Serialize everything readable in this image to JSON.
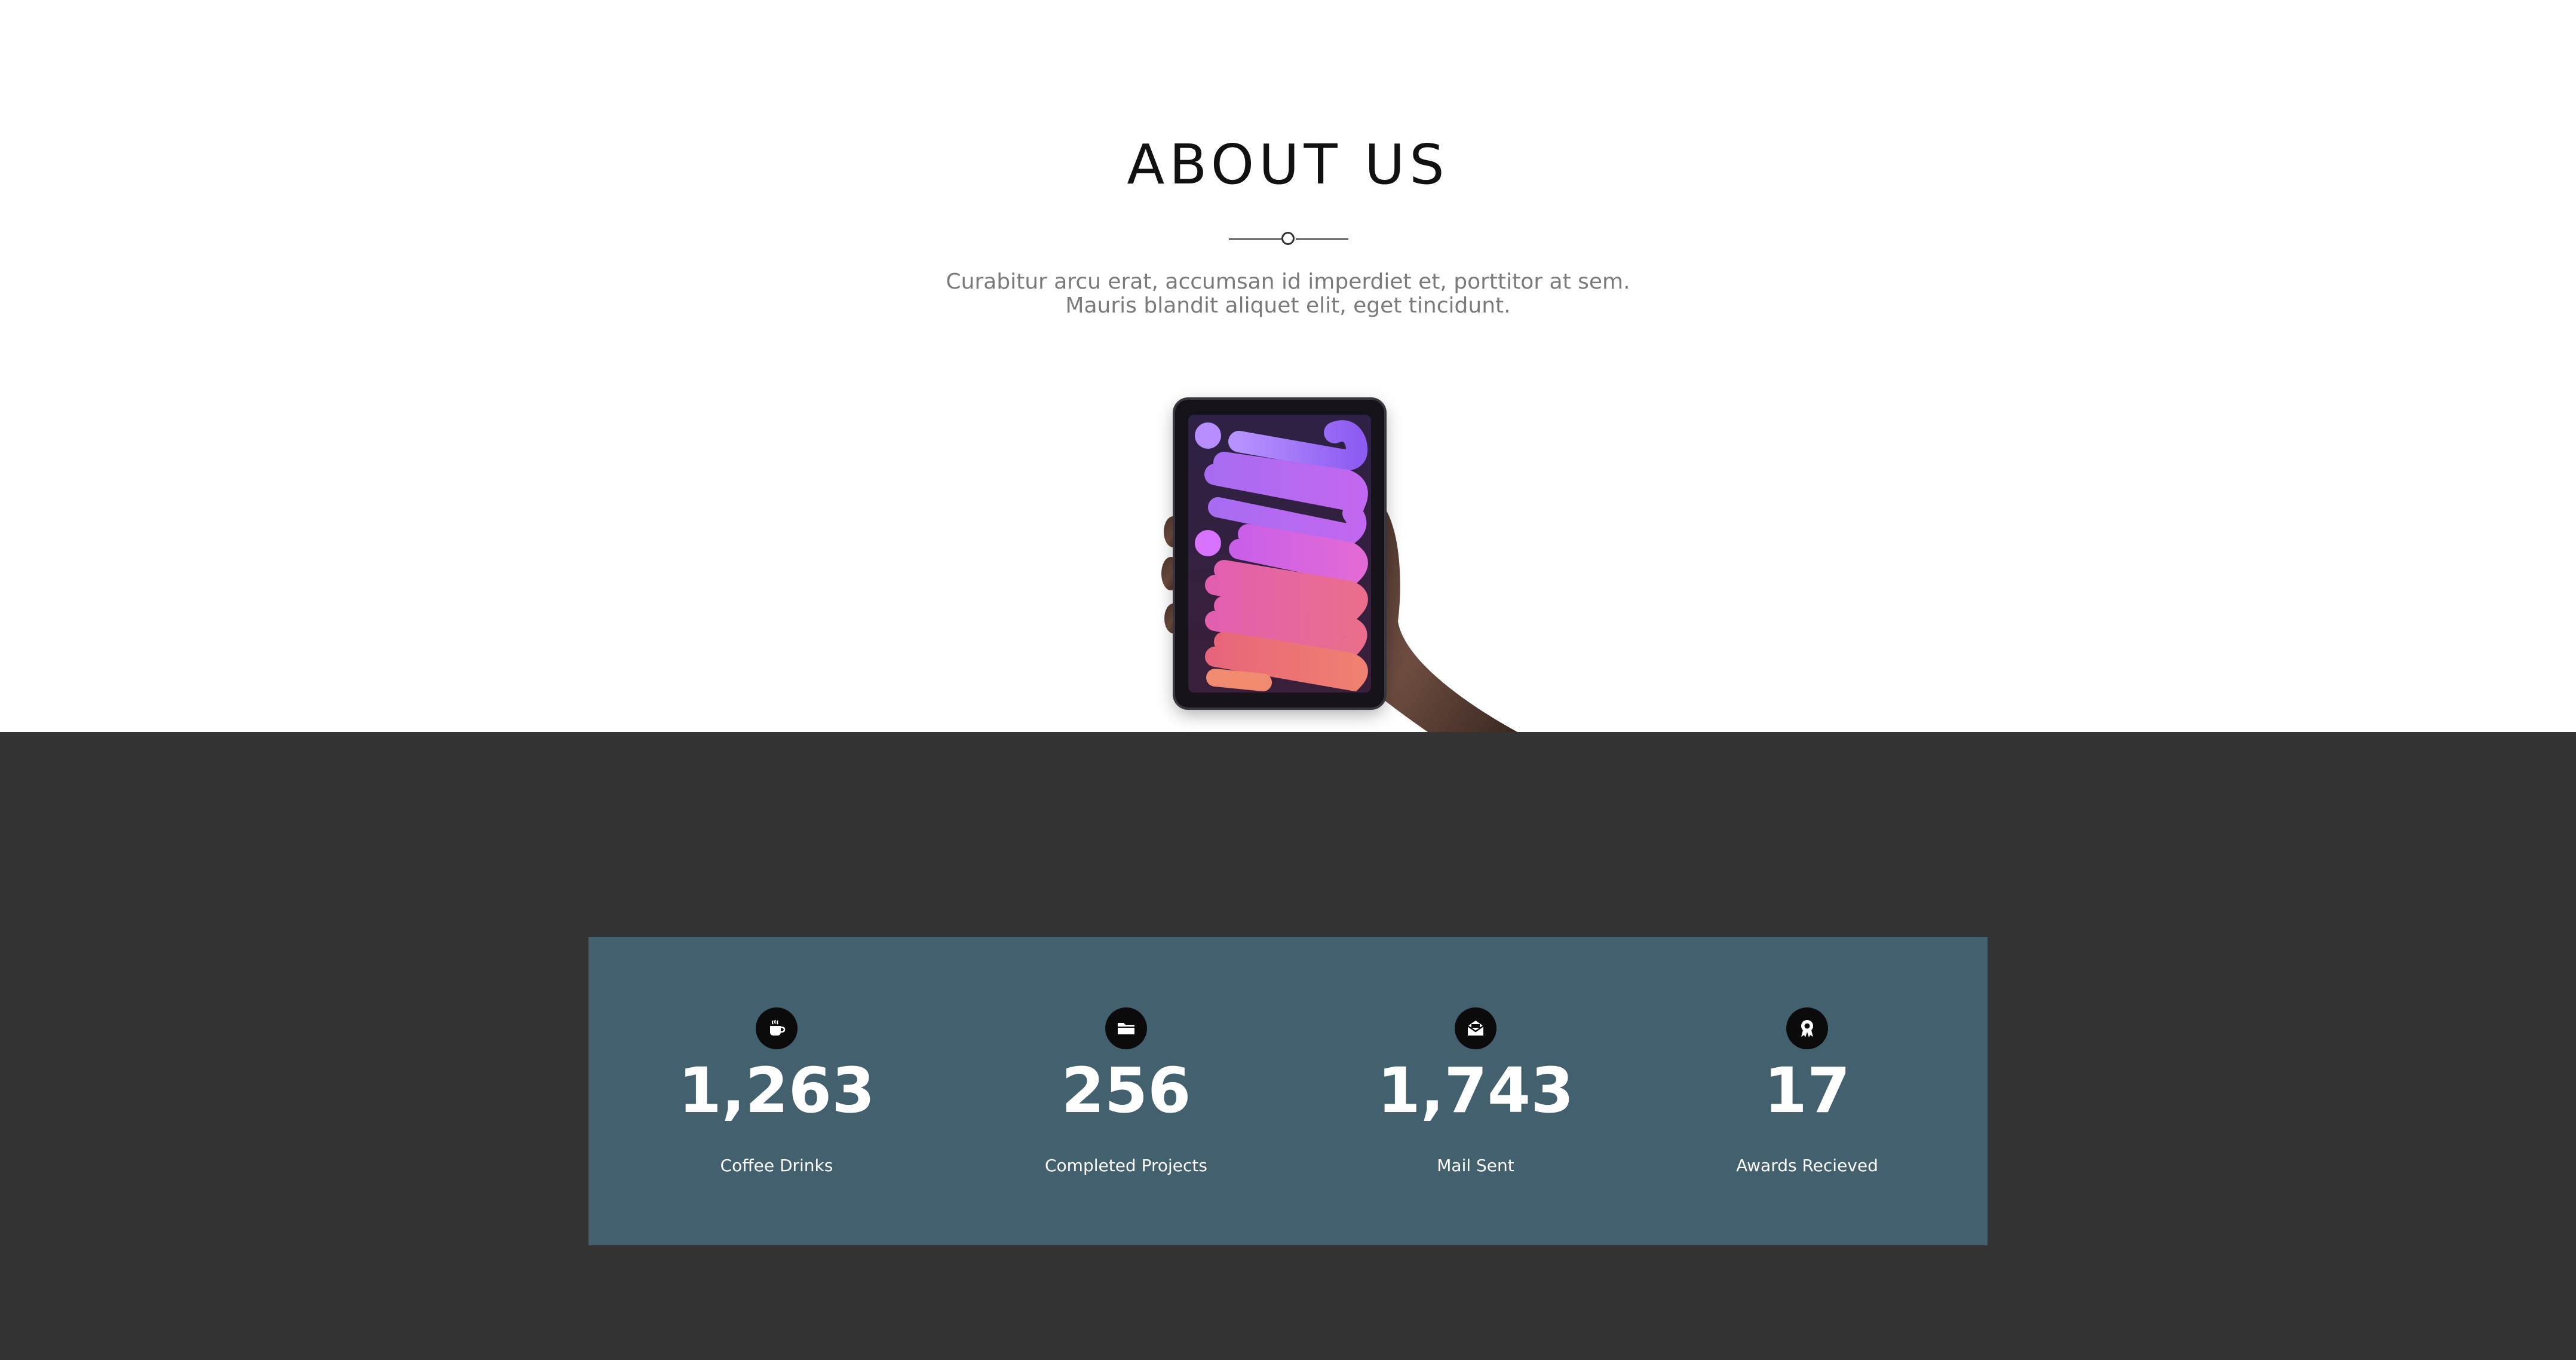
{
  "about": {
    "title": "ABOUT US",
    "text_line1": "Curabitur arcu erat, accumsan id imperdiet et, porttitor at sem.",
    "text_line2": "Mauris blandit aliquet elit, eget tincidunt."
  },
  "image": {
    "subject": "hand-holding-tablet"
  },
  "stats": [
    {
      "icon": "coffee-icon",
      "value": "1,263",
      "label": "Coffee Drinks"
    },
    {
      "icon": "folder-icon",
      "value": "256",
      "label": "Completed Projects"
    },
    {
      "icon": "mail-icon",
      "value": "1,743",
      "label": "Mail Sent"
    },
    {
      "icon": "award-icon",
      "value": "17",
      "label": "Awards Recieved"
    }
  ],
  "colors": {
    "page_bg": "#ffffff",
    "band_bg": "#333333",
    "stats_box_bg": "#42606e",
    "icon_circle": "#0b0b0b",
    "text_gray": "#7a7a7a"
  }
}
